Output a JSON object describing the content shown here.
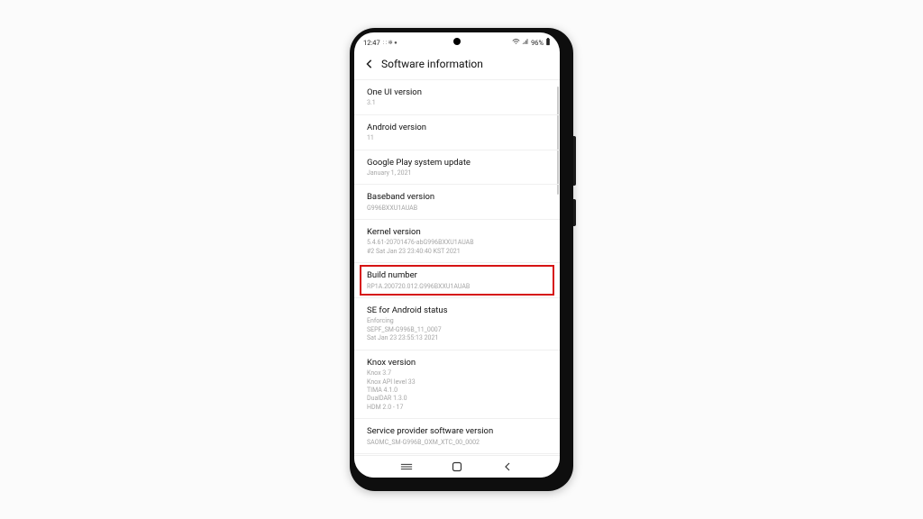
{
  "status": {
    "time": "12:47",
    "indicators": ": : ✻ ●",
    "battery": "96%"
  },
  "header": {
    "title": "Software information"
  },
  "items": [
    {
      "label": "One UI version",
      "value": "3.1",
      "interactable": true,
      "highlight": false,
      "name": "item-one-ui-version"
    },
    {
      "label": "Android version",
      "value": "11",
      "interactable": true,
      "highlight": false,
      "name": "item-android-version"
    },
    {
      "label": "Google Play system update",
      "value": "January 1, 2021",
      "interactable": true,
      "highlight": false,
      "name": "item-google-play-update"
    },
    {
      "label": "Baseband version",
      "value": "G996BXXU1AUAB",
      "interactable": true,
      "highlight": false,
      "name": "item-baseband-version"
    },
    {
      "label": "Kernel version",
      "value": "5.4.61-20701476-abG996BXXU1AUAB\n#2 Sat Jan 23 23:40:40 KST 2021",
      "interactable": true,
      "highlight": false,
      "name": "item-kernel-version"
    },
    {
      "label": "Build number",
      "value": "RP1A.200720.012.G996BXXU1AUAB",
      "interactable": true,
      "highlight": true,
      "name": "item-build-number"
    },
    {
      "label": "SE for Android status",
      "value": "Enforcing\nSEPF_SM-G996B_11_0007\nSat Jan 23 23:55:13 2021",
      "interactable": true,
      "highlight": false,
      "name": "item-se-android-status"
    },
    {
      "label": "Knox version",
      "value": "Knox 3.7\nKnox API level 33\nTIMA 4.1.0\nDualDAR 1.3.0\nHDM 2.0 - 17",
      "interactable": true,
      "highlight": false,
      "name": "item-knox-version"
    },
    {
      "label": "Service provider software version",
      "value": "SAOMC_SM-G996B_OXM_XTC_00_0002",
      "interactable": true,
      "highlight": false,
      "name": "item-service-provider-version"
    }
  ]
}
